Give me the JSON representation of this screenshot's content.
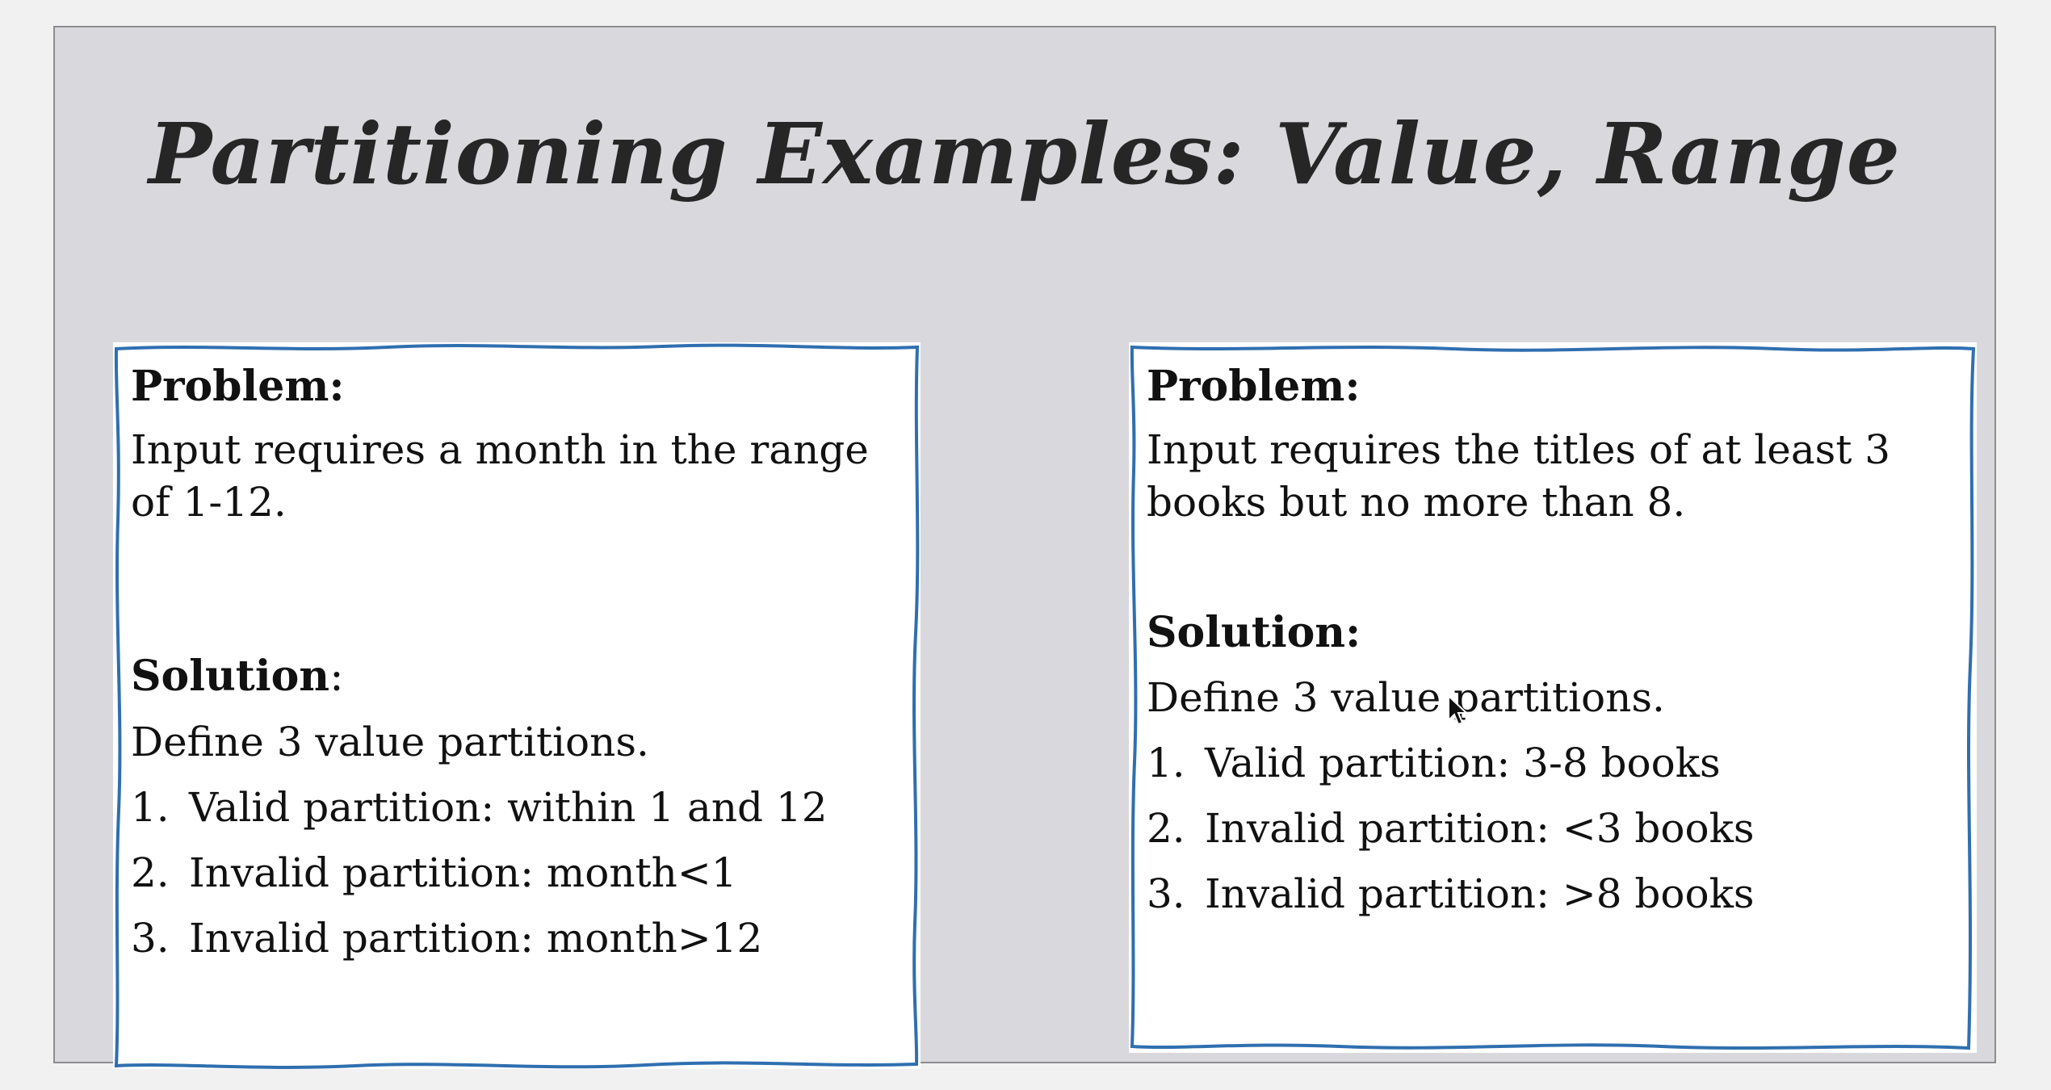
{
  "slide": {
    "title": "Partitioning Examples: Value, Range"
  },
  "left_card": {
    "problem_heading": "Problem:",
    "problem_text": "Input requires a month in the range of 1-12.",
    "solution_heading": "Solution",
    "solution_colon": ":",
    "solution_intro": "Define 3 value partitions.",
    "items": [
      {
        "num": "1.",
        "text": "Valid partition: within 1 and 12"
      },
      {
        "num": "2.",
        "text": "Invalid partition: month<1"
      },
      {
        "num": "3.",
        "text": "Invalid partition: month>12"
      }
    ]
  },
  "right_card": {
    "problem_heading": "Problem:",
    "problem_text": "Input requires the titles of at least 3 books but no more than 8.",
    "solution_heading": "Solution:",
    "solution_intro": "Define 3 value partitions.",
    "items": [
      {
        "num": "1.",
        "text": "Valid partition: 3-8 books"
      },
      {
        "num": "2.",
        "text": "Invalid partition: <3 books"
      },
      {
        "num": "3.",
        "text": "Invalid partition: >8 books"
      }
    ]
  },
  "colors": {
    "slide_background": "#d9d8dc",
    "card_border": "#2f6fb0",
    "title_text": "#262626"
  }
}
